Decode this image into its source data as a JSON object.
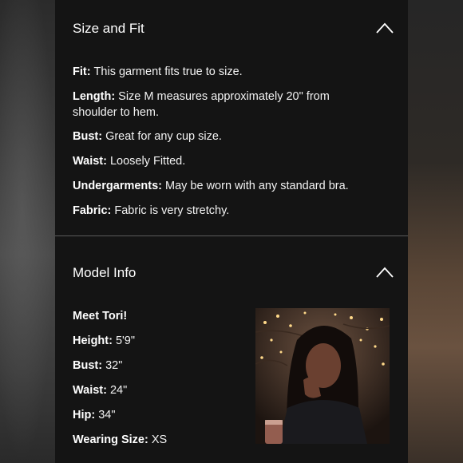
{
  "size_fit": {
    "title": "Size and Fit",
    "rows": [
      {
        "key": "Fit:",
        "value": "This garment fits true to size."
      },
      {
        "key": "Length:",
        "value": "Size M measures approximately 20\" from shoulder to hem."
      },
      {
        "key": "Bust:",
        "value": "Great for any cup size."
      },
      {
        "key": "Waist:",
        "value": "Loosely Fitted."
      },
      {
        "key": "Undergarments:",
        "value": "May be worn with any standard bra."
      },
      {
        "key": "Fabric:",
        "value": "Fabric is very stretchy."
      }
    ]
  },
  "model_info": {
    "title": "Model Info",
    "intro": "Meet Tori!",
    "rows": [
      {
        "key": "Height:",
        "value": "5'9\""
      },
      {
        "key": "Bust:",
        "value": "32\""
      },
      {
        "key": "Waist:",
        "value": "24\""
      },
      {
        "key": "Hip:",
        "value": "34\""
      },
      {
        "key": "Wearing Size:",
        "value": "XS"
      }
    ]
  },
  "icons": {
    "collapse": "chevron-up-icon"
  },
  "colors": {
    "panel_bg": "#141414",
    "text": "#ffffff",
    "divider": "#5a5a5a"
  }
}
